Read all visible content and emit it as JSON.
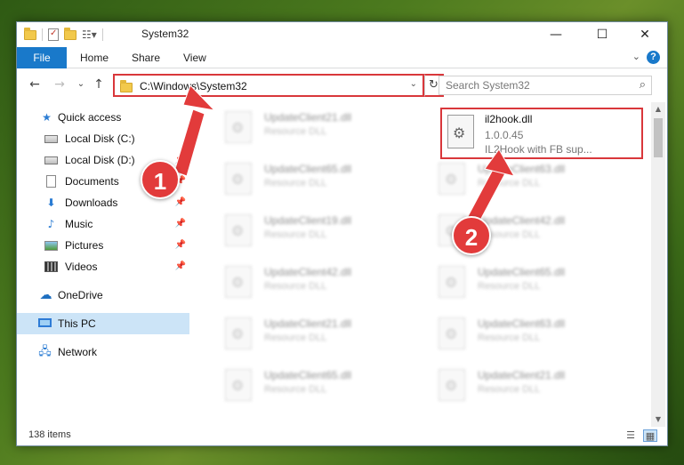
{
  "window": {
    "title": "System32",
    "controls": {
      "minimize": "—",
      "maximize": "☐",
      "close": "✕"
    }
  },
  "ribbon": {
    "tabs": [
      "File",
      "Home",
      "Share",
      "View"
    ],
    "expand_glyph": "⌄",
    "help_glyph": "?"
  },
  "address": {
    "path": "C:\\Windows\\System32",
    "dropdown_glyph": "⌄",
    "refresh_glyph": "↻"
  },
  "search": {
    "placeholder": "Search System32",
    "icon_glyph": "⌕"
  },
  "nav": {
    "back": "←",
    "forward": "→",
    "recent": "⌄",
    "up": "↑"
  },
  "sidebar": {
    "items": [
      {
        "label": "Quick access",
        "pinned": false
      },
      {
        "label": "Local Disk (C:)",
        "pinned": true
      },
      {
        "label": "Local Disk (D:)",
        "pinned": true
      },
      {
        "label": "Documents",
        "pinned": true
      },
      {
        "label": "Downloads",
        "pinned": true
      },
      {
        "label": "Music",
        "pinned": true
      },
      {
        "label": "Pictures",
        "pinned": true
      },
      {
        "label": "Videos",
        "pinned": true
      },
      {
        "label": "OneDrive",
        "pinned": false
      },
      {
        "label": "This PC",
        "pinned": false
      },
      {
        "label": "Network",
        "pinned": false
      }
    ],
    "pin_glyph": "📌"
  },
  "files": {
    "highlighted": {
      "name": "il2hook.dll",
      "version": "1.0.0.45",
      "description": "IL2Hook with FB sup..."
    },
    "blurred": [
      {
        "name": "UpdateClient21.dll",
        "type": "Resource DLL"
      },
      {
        "name": "UpdateClient65.dll",
        "type": "Resource DLL"
      },
      {
        "name": "UpdateClient63.dll",
        "type": "Resource DLL"
      },
      {
        "name": "UpdateClient19.dll",
        "type": "Resource DLL"
      },
      {
        "name": "UpdateClient42.dll",
        "type": "Resource DLL"
      },
      {
        "name": "UpdateClient42.dll",
        "type": "Resource DLL"
      },
      {
        "name": "UpdateClient65.dll",
        "type": "Resource DLL"
      },
      {
        "name": "UpdateClient21.dll",
        "type": "Resource DLL"
      },
      {
        "name": "UpdateClient63.dll",
        "type": "Resource DLL"
      },
      {
        "name": "UpdateClient65.dll",
        "type": "Resource DLL"
      },
      {
        "name": "UpdateClient21.dll",
        "type": "Resource DLL"
      }
    ]
  },
  "status": {
    "item_count": "138 items"
  },
  "annotations": {
    "step1": "1",
    "step2": "2",
    "color": "#e23b3b"
  }
}
